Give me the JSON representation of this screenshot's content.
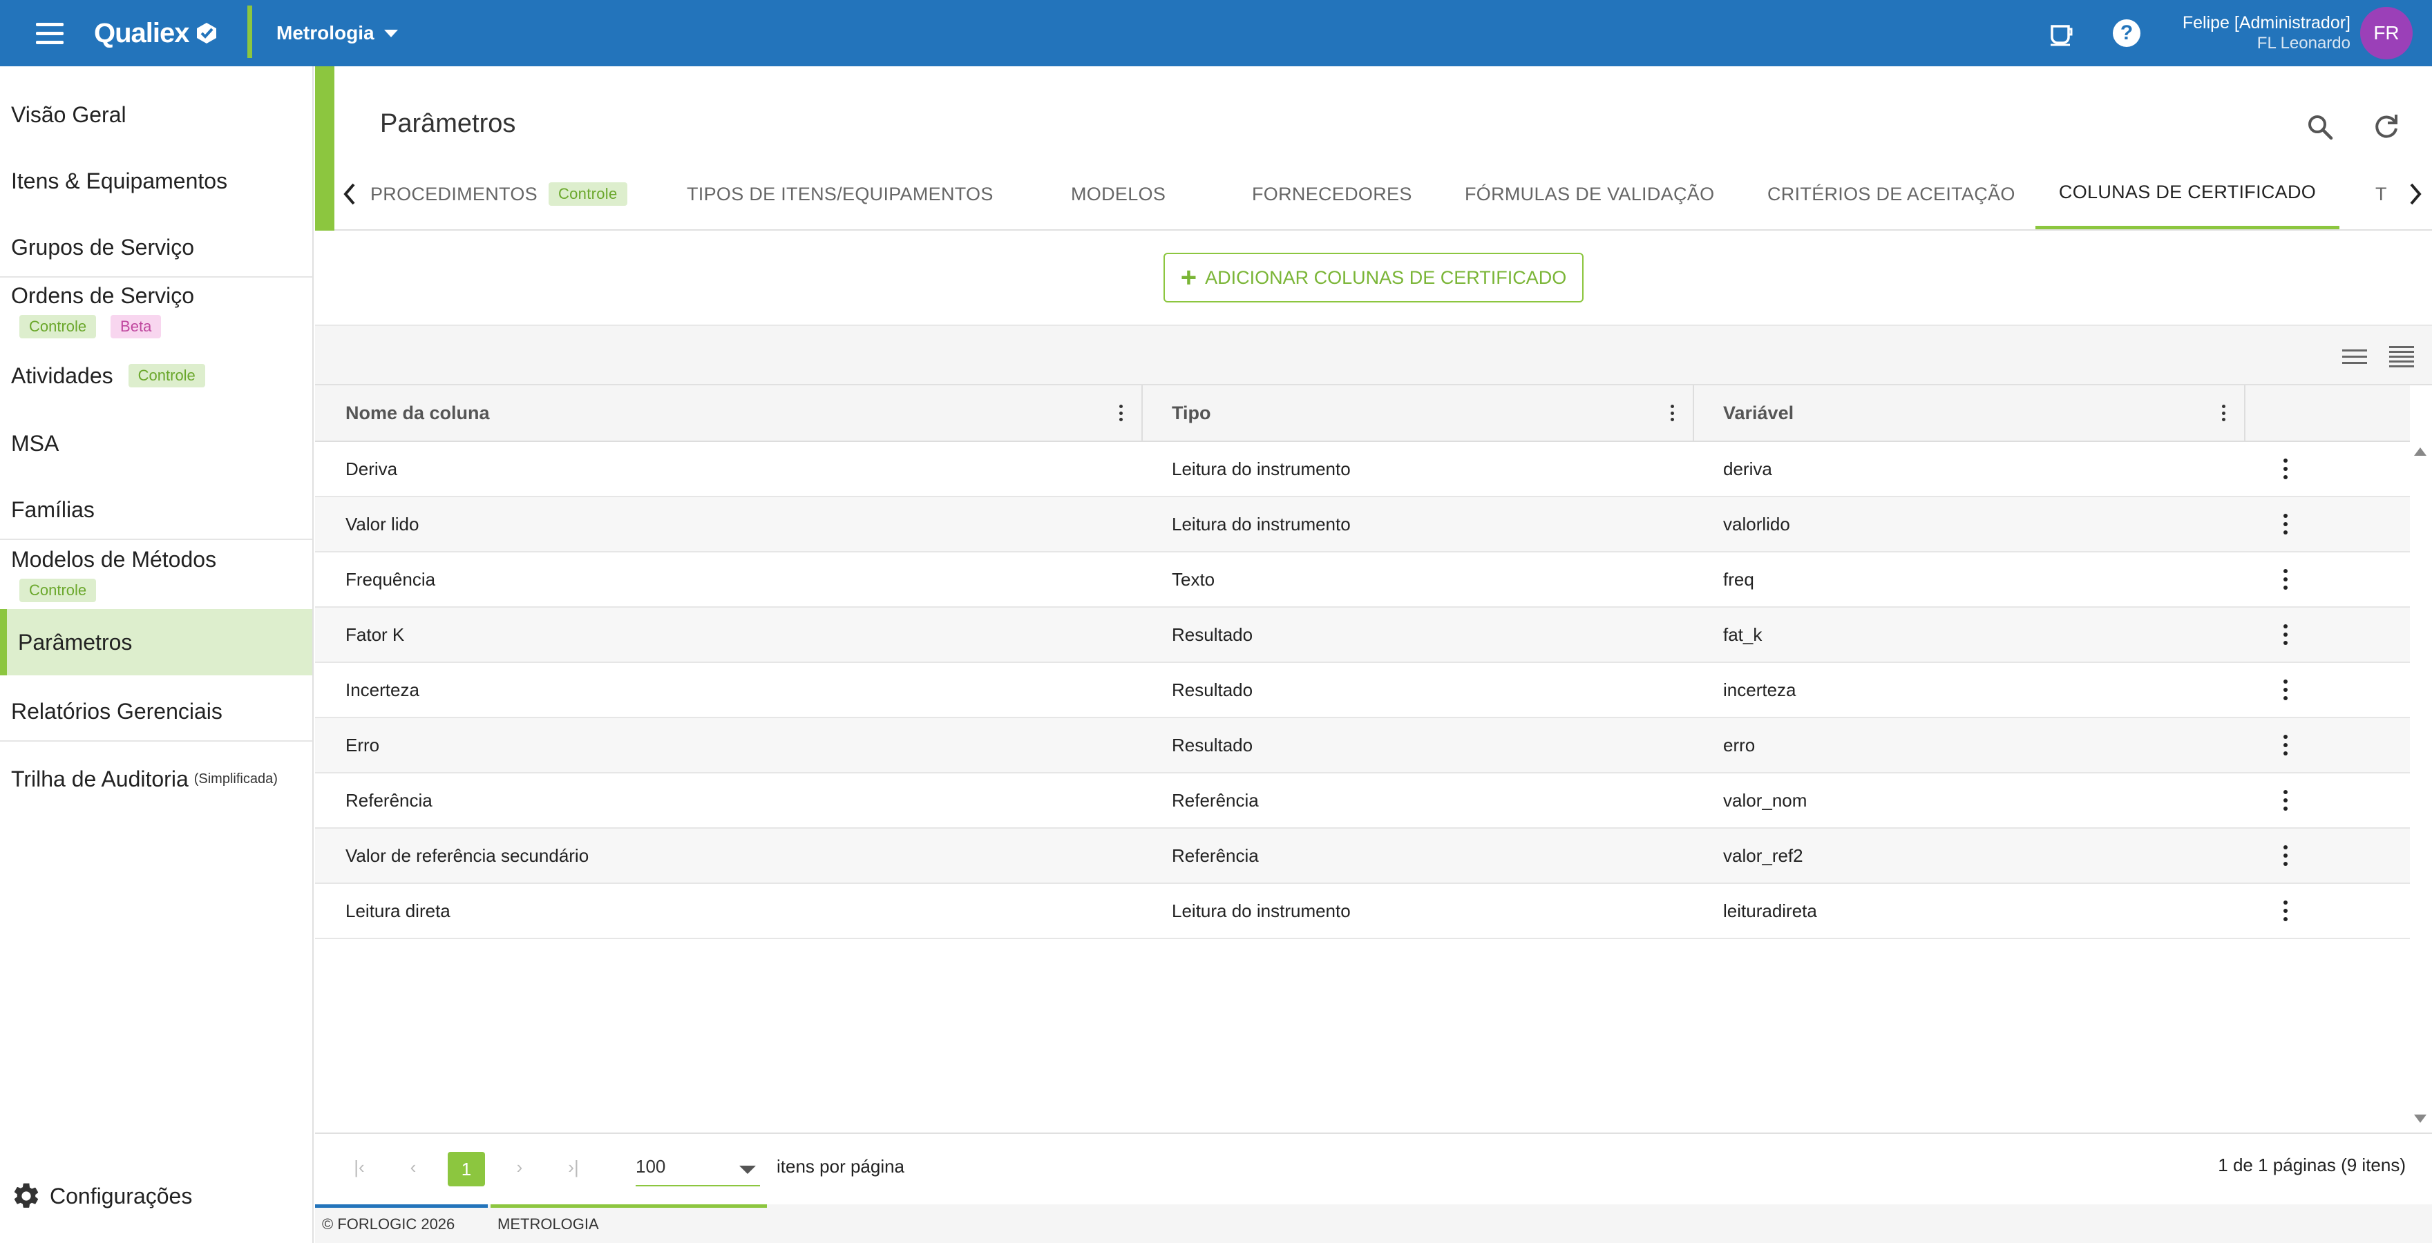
{
  "app": {
    "brand": "Qualiex",
    "module": "Metrologia"
  },
  "user": {
    "name": "Felipe [Administrador]",
    "org": "FL Leonardo",
    "initials": "FR"
  },
  "colors": {
    "topbar": "#2374bb",
    "accent": "#8cc63f",
    "avatar": "#9b40b8",
    "badge_beta": "#c0489f"
  },
  "sidebar": {
    "items": [
      {
        "label": "Visão Geral"
      },
      {
        "label": "Itens & Equipamentos"
      },
      {
        "label": "Grupos de Serviço"
      },
      {
        "label": "Ordens de Serviço",
        "badges": [
          "Controle",
          "Beta"
        ]
      },
      {
        "label": "Atividades",
        "badges": [
          "Controle"
        ]
      },
      {
        "label": "MSA"
      },
      {
        "label": "Famílias"
      },
      {
        "label": "Modelos de Métodos",
        "badges": [
          "Controle"
        ]
      },
      {
        "label": "Parâmetros",
        "active": true
      },
      {
        "label": "Relatórios Gerenciais"
      },
      {
        "label": "Trilha de Auditoria",
        "note": "(Simplificada)"
      }
    ],
    "config_label": "Configurações"
  },
  "page": {
    "title": "Parâmetros",
    "tabs": [
      {
        "label": "PROCEDIMENTOS",
        "badge": "Controle"
      },
      {
        "label": "TIPOS DE ITENS/EQUIPAMENTOS"
      },
      {
        "label": "MODELOS"
      },
      {
        "label": "FORNECEDORES"
      },
      {
        "label": "FÓRMULAS DE VALIDAÇÃO"
      },
      {
        "label": "CRITÉRIOS DE ACEITAÇÃO"
      },
      {
        "label": "COLUNAS DE CERTIFICADO",
        "active": true
      },
      {
        "label": "T"
      }
    ],
    "add_button": "ADICIONAR COLUNAS DE CERTIFICADO"
  },
  "grid": {
    "columns": [
      "Nome da coluna",
      "Tipo",
      "Variável"
    ],
    "rows": [
      [
        "Deriva",
        "Leitura do instrumento",
        "deriva"
      ],
      [
        "Valor lido",
        "Leitura do instrumento",
        "valorlido"
      ],
      [
        "Frequência",
        "Texto",
        "freq"
      ],
      [
        "Fator K",
        "Resultado",
        "fat_k"
      ],
      [
        "Incerteza",
        "Resultado",
        "incerteza"
      ],
      [
        "Erro",
        "Resultado",
        "erro"
      ],
      [
        "Referência",
        "Referência",
        "valor_nom"
      ],
      [
        "Valor de referência secundário",
        "Referência",
        "valor_ref2"
      ],
      [
        "Leitura direta",
        "Leitura do instrumento",
        "leituradireta"
      ]
    ]
  },
  "pager": {
    "current_page": "1",
    "page_size": "100",
    "page_size_label": "itens por página",
    "info": "1 de 1 páginas (9 itens)"
  },
  "footer": {
    "copyright": "© FORLOGIC 2026",
    "module": "METROLOGIA"
  }
}
